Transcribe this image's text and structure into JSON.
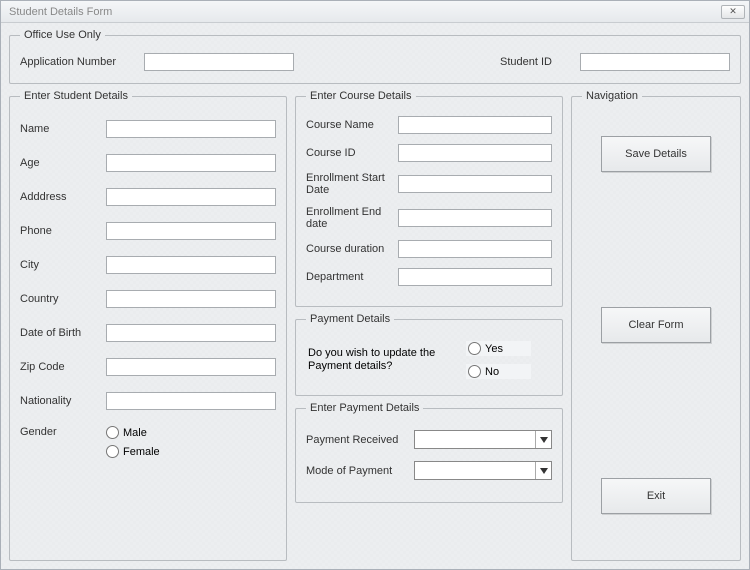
{
  "window": {
    "title": "Student Details Form"
  },
  "office": {
    "legend": "Office Use Only",
    "app_num_label": "Application Number",
    "app_num_value": "",
    "student_id_label": "Student ID",
    "student_id_value": ""
  },
  "student": {
    "legend": "Enter Student Details",
    "name_label": "Name",
    "name_value": "",
    "age_label": "Age",
    "age_value": "",
    "address_label": "Adddress",
    "address_value": "",
    "phone_label": "Phone",
    "phone_value": "",
    "city_label": "City",
    "city_value": "",
    "country_label": "Country",
    "country_value": "",
    "dob_label": "Date of Birth",
    "dob_value": "",
    "zip_label": "Zip Code",
    "zip_value": "",
    "nationality_label": "Nationality",
    "nationality_value": "",
    "gender_label": "Gender",
    "gender_male": "Male",
    "gender_female": "Female"
  },
  "course": {
    "legend": "Enter Course Details",
    "name_label": "Course Name",
    "name_value": "",
    "id_label": "Course ID",
    "id_value": "",
    "start_label": "Enrollment Start Date",
    "start_value": "",
    "end_label": "Enrollment End date",
    "end_value": "",
    "duration_label": "Course duration",
    "duration_value": "",
    "dept_label": "Department",
    "dept_value": ""
  },
  "payment_q": {
    "legend": "Payment Details",
    "question": "Do you wish to update the Payment details?",
    "yes": "Yes",
    "no": "No"
  },
  "payment": {
    "legend": "Enter Payment Details",
    "received_label": "Payment Received",
    "received_value": "",
    "mode_label": "Mode of Payment",
    "mode_value": ""
  },
  "nav": {
    "legend": "Navigation",
    "save": "Save Details",
    "clear": "Clear Form",
    "exit": "Exit"
  }
}
